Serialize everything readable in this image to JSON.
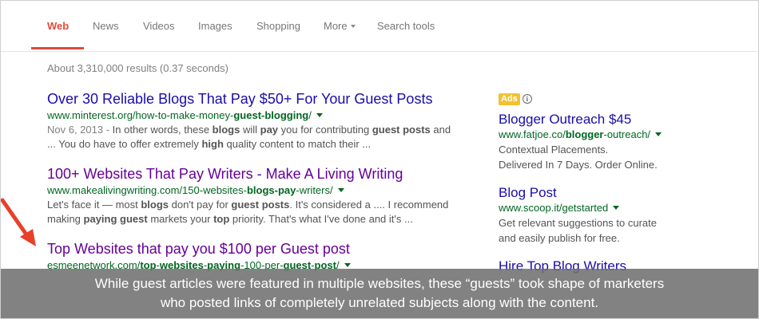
{
  "tabs": [
    {
      "label": "Web",
      "active": true
    },
    {
      "label": "News"
    },
    {
      "label": "Videos"
    },
    {
      "label": "Images"
    },
    {
      "label": "Shopping"
    },
    {
      "label": "More"
    },
    {
      "label": "Search tools"
    }
  ],
  "stats": "About 3,310,000 results (0.37 seconds)",
  "results": [
    {
      "title": "Over 30 Reliable Blogs That Pay $50+ For Your Guest Posts",
      "url": {
        "pre": "www.minterest.org/how-to-make-money-",
        "bold": "guest-blogging",
        "post": "/"
      },
      "date": "Nov 6, 2013 - ",
      "snippet1": {
        "a": "In other words, these ",
        "b1": "blogs",
        "c": " will ",
        "b2": "pay",
        "d": " you for contributing ",
        "b3": "guest posts",
        "e": " and"
      },
      "snippet2": {
        "a": "... You do have to offer extremely ",
        "b1": "high",
        "c": " quality content to match their ..."
      }
    },
    {
      "title": "100+ Websites That Pay Writers - Make A Living Writing",
      "url": {
        "pre": "www.makealivingwriting.com/150-websites-",
        "bold": "blogs-pay",
        "post": "-writers/"
      },
      "snippet1": {
        "a": "Let's face it — most ",
        "b1": "blogs",
        "c": " don't pay for ",
        "b2": "guest posts",
        "d": ". It's considered a .... I recommend"
      },
      "snippet2": {
        "a": "making ",
        "b1": "paying guest",
        "c": " markets your ",
        "b2": "top",
        "d": " priority. That's what I've done and it's ..."
      }
    },
    {
      "title": "Top Websites that pay you $100 per Guest post",
      "url": {
        "pre": "esmeenetwork.com/",
        "bold1": "top",
        "mid1": "-",
        "bold2": "websites",
        "mid2": "-",
        "bold3": "paying",
        "mid3": "-100-per-",
        "bold4": "guest",
        "mid4": "-",
        "bold5": "post",
        "post": "/"
      }
    }
  ],
  "ads_label": "Ads",
  "ads": [
    {
      "title": "Blogger Outreach $45",
      "url": {
        "pre": "www.fatjoe.co/",
        "bold": "blogger",
        "post": "-outreach/"
      },
      "desc1": "Contextual Placements.",
      "desc2": "Delivered In 7 Days. Order Online."
    },
    {
      "title": "Blog Post",
      "url": {
        "pre": "www.scoop.it/getstarted",
        "bold": "",
        "post": ""
      },
      "desc1": "Get relevant suggestions to curate",
      "desc2": "and easily publish for free."
    },
    {
      "title": "Hire Top Blog Writers"
    }
  ],
  "caption": {
    "line1": "While guest articles were featured in multiple websites, these “guests” took shape of marketers",
    "line2": "who posted links of completely unrelated subjects along with the content."
  },
  "colors": {
    "accent": "#dd4b39",
    "link": "#1a0dab",
    "visited": "#660099",
    "url": "#006621",
    "ads_badge": "#f1c232"
  }
}
